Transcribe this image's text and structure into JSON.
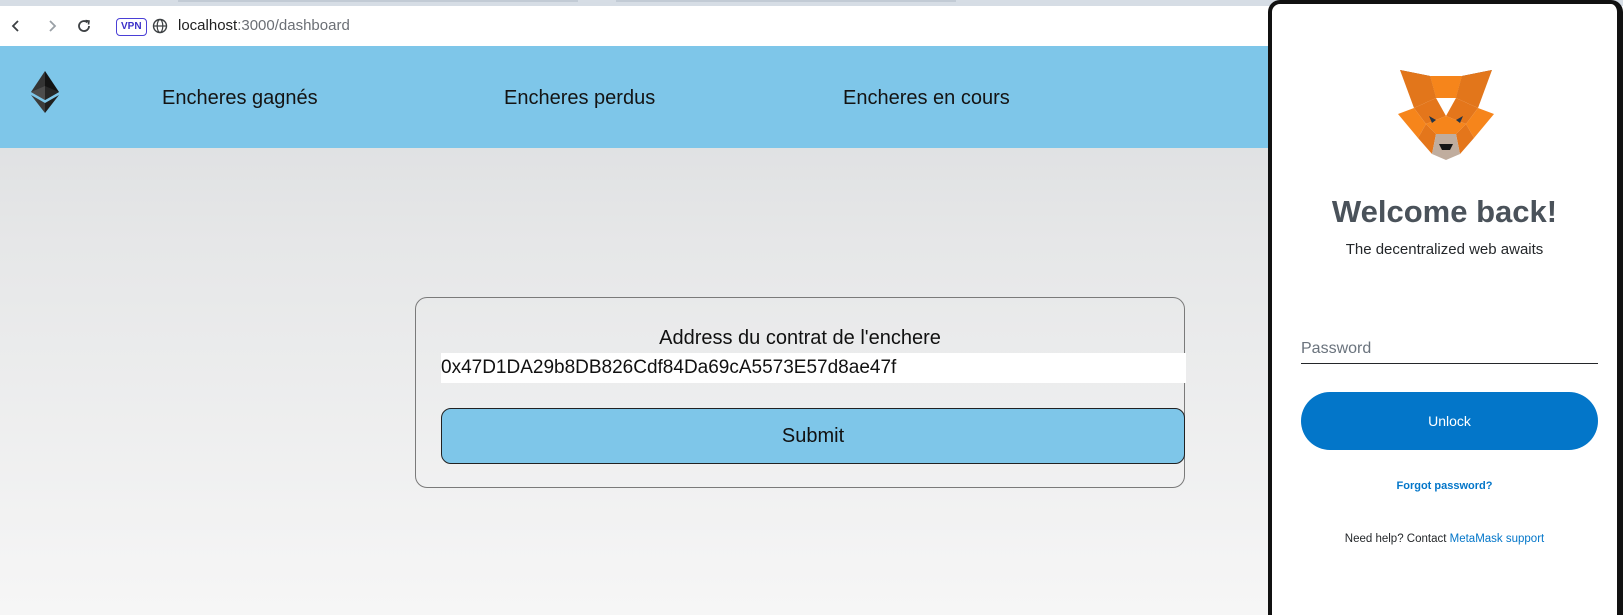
{
  "browser": {
    "url_host": "localhost",
    "url_path": ":3000/dashboard",
    "vpn_label": "VPN"
  },
  "navbar": {
    "logo_icon": "ethereum-icon",
    "links": [
      "Encheres gagnés",
      "Encheres perdus",
      "Encheres en cours"
    ]
  },
  "form": {
    "label": "Address du contrat de l'enchere",
    "address_value": "0x47D1DA29b8DB826Cdf84Da69cA5573E57d8ae47f",
    "submit_label": "Submit"
  },
  "metamask": {
    "title": "Welcome back!",
    "subtitle": "The decentralized web awaits",
    "password_placeholder": "Password",
    "unlock_label": "Unlock",
    "forgot_label": "Forgot password?",
    "help_text": "Need help? Contact ",
    "support_link": "MetaMask support"
  },
  "colors": {
    "navbar": "#7ec6e9",
    "metamask_blue": "#0376c9",
    "fox_orange": "#f6851b"
  }
}
